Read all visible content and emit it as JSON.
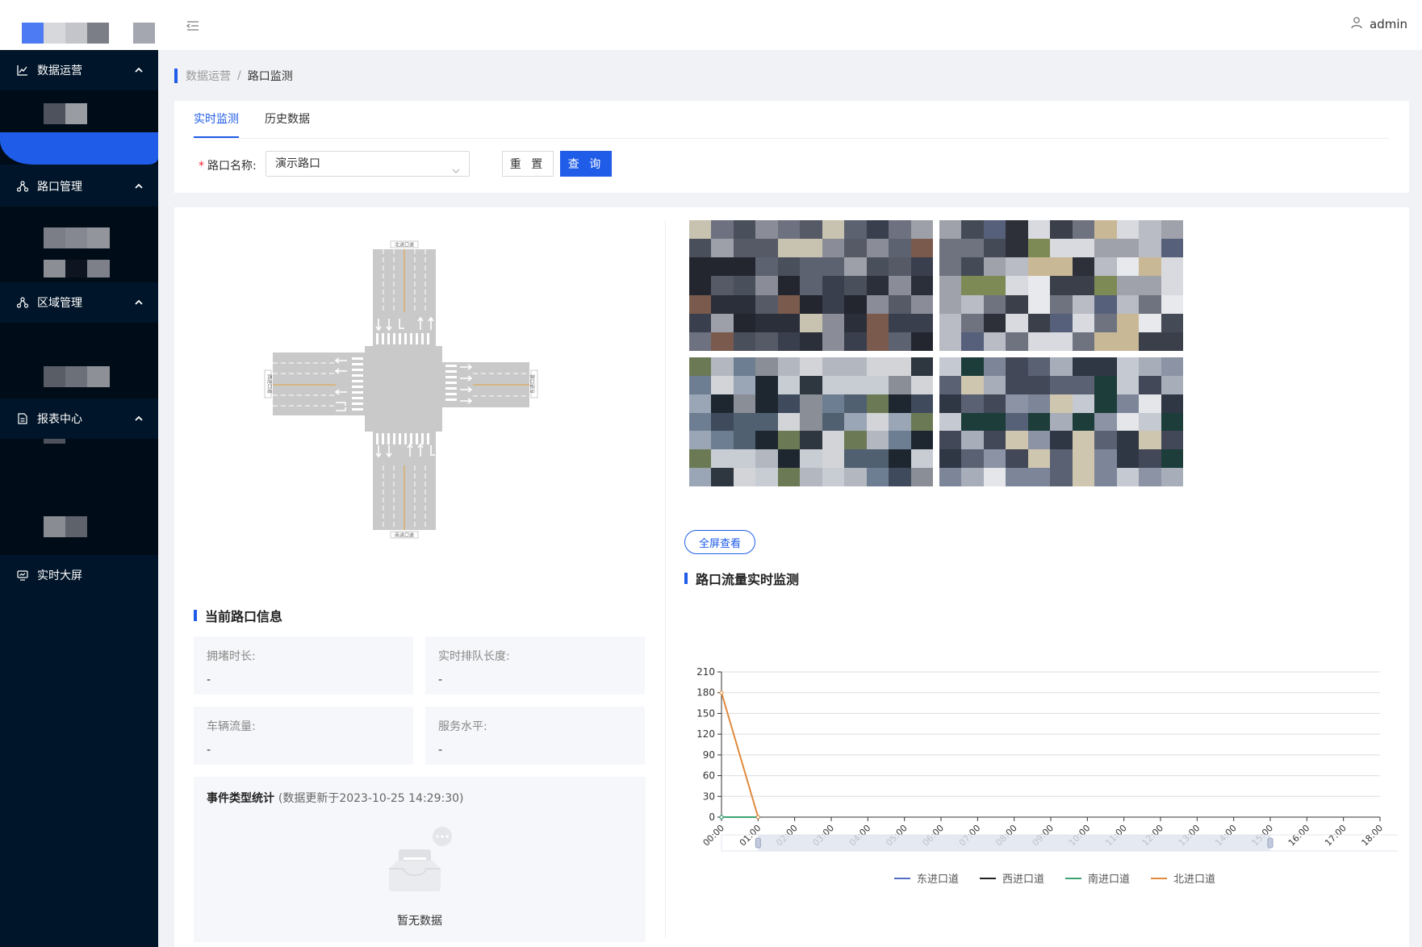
{
  "header": {
    "user_name": "admin"
  },
  "sidebar": {
    "groups": [
      {
        "label": "数据运营",
        "icon": "line-chart-icon"
      },
      {
        "label": "路口管理",
        "icon": "cluster-icon"
      },
      {
        "label": "区域管理",
        "icon": "cluster-icon"
      },
      {
        "label": "报表中心",
        "icon": "file-icon"
      }
    ],
    "screen_item": {
      "label": "实时大屏",
      "icon": "monitor-icon"
    }
  },
  "breadcrumb": {
    "parent": "数据运营",
    "separator": "/",
    "current": "路口监测"
  },
  "tabs": [
    {
      "label": "实时监测",
      "active": true
    },
    {
      "label": "历史数据",
      "active": false
    }
  ],
  "filter": {
    "label": "路口名称:",
    "required_mark": "*",
    "selected": "演示路口",
    "reset_label": "重 置",
    "query_label": "查 询"
  },
  "intersection": {
    "north_label": "北进口道",
    "south_label": "南进口道",
    "west_label": "西进口道",
    "east_label": "东进口道"
  },
  "info": {
    "title": "当前路口信息",
    "cells": [
      {
        "label": "拥堵时长:",
        "value": "-"
      },
      {
        "label": "实时排队长度:",
        "value": "-"
      },
      {
        "label": "车辆流量:",
        "value": "-"
      },
      {
        "label": "服务水平:",
        "value": "-"
      }
    ]
  },
  "events": {
    "title": "事件类型统计",
    "subtitle": "(数据更新于2023-10-25 14:29:30)",
    "empty_text": "暂无数据"
  },
  "video": {
    "fullscreen_label": "全屏查看"
  },
  "flow_section": {
    "title": "路口流量实时监测"
  },
  "colors": {
    "accent": "#1f5ce8",
    "sidebar_bg": "#001529",
    "east": "#5470c6",
    "west": "#222222",
    "south": "#3ba272",
    "north": "#e08a3c"
  },
  "chart_data": {
    "type": "line",
    "title": "",
    "xlabel": "",
    "ylabel": "",
    "categories": [
      "00:00",
      "01:00",
      "02:00",
      "03:00",
      "04:00",
      "05:00",
      "06:00",
      "07:00",
      "08:00",
      "09:00",
      "10:00",
      "11:00",
      "12:00",
      "13:00",
      "14:00",
      "15:00",
      "16:00",
      "17:00",
      "18:00"
    ],
    "ylim": [
      0,
      210
    ],
    "yticks": [
      0,
      30,
      60,
      90,
      120,
      150,
      180,
      210
    ],
    "grid": true,
    "legend_position": "bottom",
    "series": [
      {
        "name": "东进口道",
        "color": "#5470c6",
        "values": [
          0,
          0
        ]
      },
      {
        "name": "西进口道",
        "color": "#222222",
        "values": [
          0,
          0
        ]
      },
      {
        "name": "南进口道",
        "color": "#3ba272",
        "values": [
          0,
          0
        ]
      },
      {
        "name": "北进口道",
        "color": "#e08a3c",
        "values": [
          180,
          0
        ]
      }
    ],
    "data_zoom": {
      "start": "01:00",
      "end": "15:00"
    }
  }
}
